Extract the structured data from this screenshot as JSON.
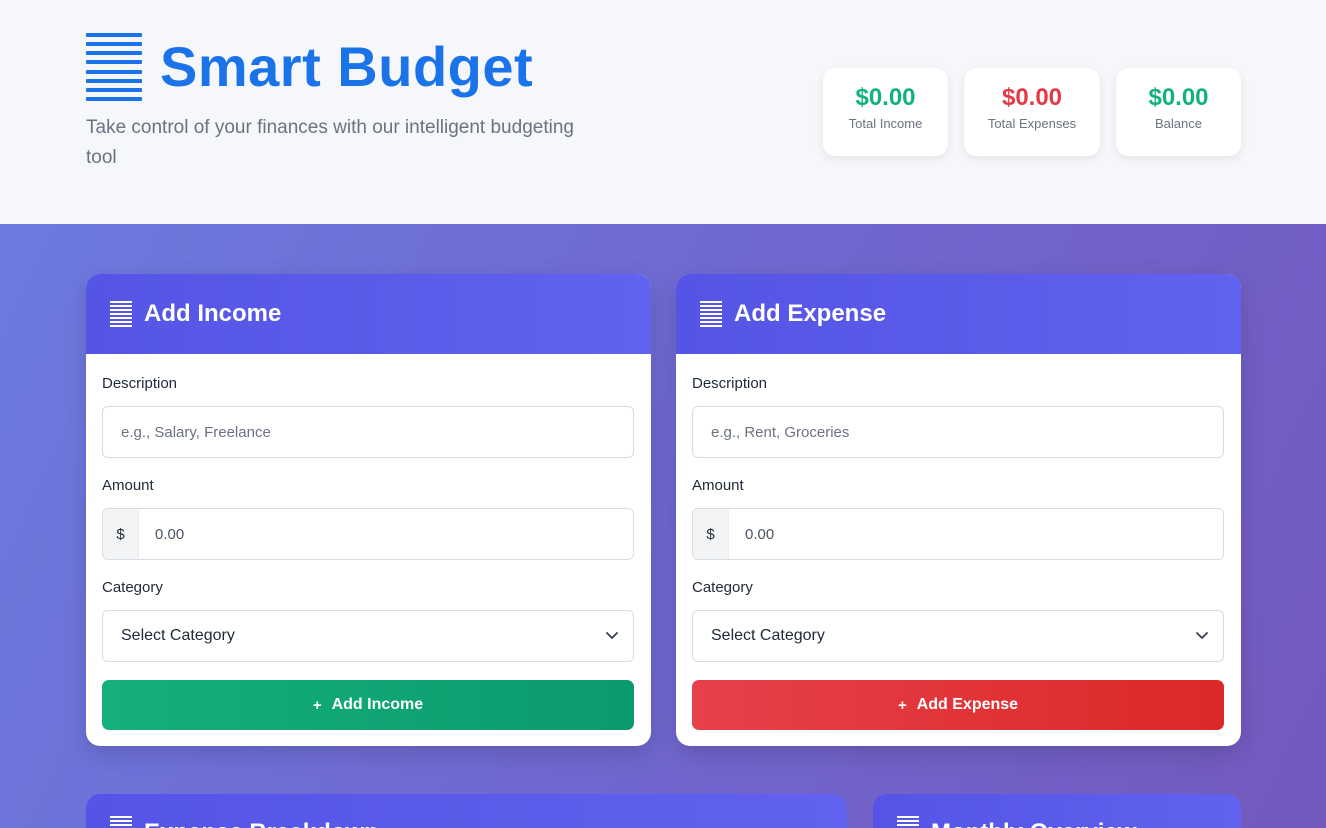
{
  "header": {
    "title": "Smart Budget",
    "tagline": "Take control of your finances with our intelligent budgeting tool",
    "stats": [
      {
        "value": "$0.00",
        "label": "Total Income",
        "color": "#10b47a"
      },
      {
        "value": "$0.00",
        "label": "Total Expenses",
        "color": "#e53945"
      },
      {
        "value": "$0.00",
        "label": "Balance",
        "color": "#10b47a"
      }
    ]
  },
  "income": {
    "title": "Add Income",
    "description_label": "Description",
    "description_placeholder": "e.g., Salary, Freelance",
    "amount_label": "Amount",
    "currency": "$",
    "amount_placeholder": "0.00",
    "category_label": "Category",
    "category_selected": "Select Category",
    "button_label": "Add Income",
    "button_icon": "+"
  },
  "expense": {
    "title": "Add Expense",
    "description_label": "Description",
    "description_placeholder": "e.g., Rent, Groceries",
    "amount_label": "Amount",
    "currency": "$",
    "amount_placeholder": "0.00",
    "category_label": "Category",
    "category_selected": "Select Category",
    "button_label": "Add Expense",
    "button_icon": "+"
  },
  "lower": {
    "left_title": "Expense Breakdown",
    "right_title": "Monthly Overview"
  },
  "icons": {
    "brand": "list-lines-icon",
    "card_header": "list-lines-icon",
    "select": "chevron-down-icon"
  },
  "colors": {
    "brand": "#1a73e8",
    "income": "#10b47a",
    "expense": "#e53945",
    "card_header": "#5554e6"
  }
}
